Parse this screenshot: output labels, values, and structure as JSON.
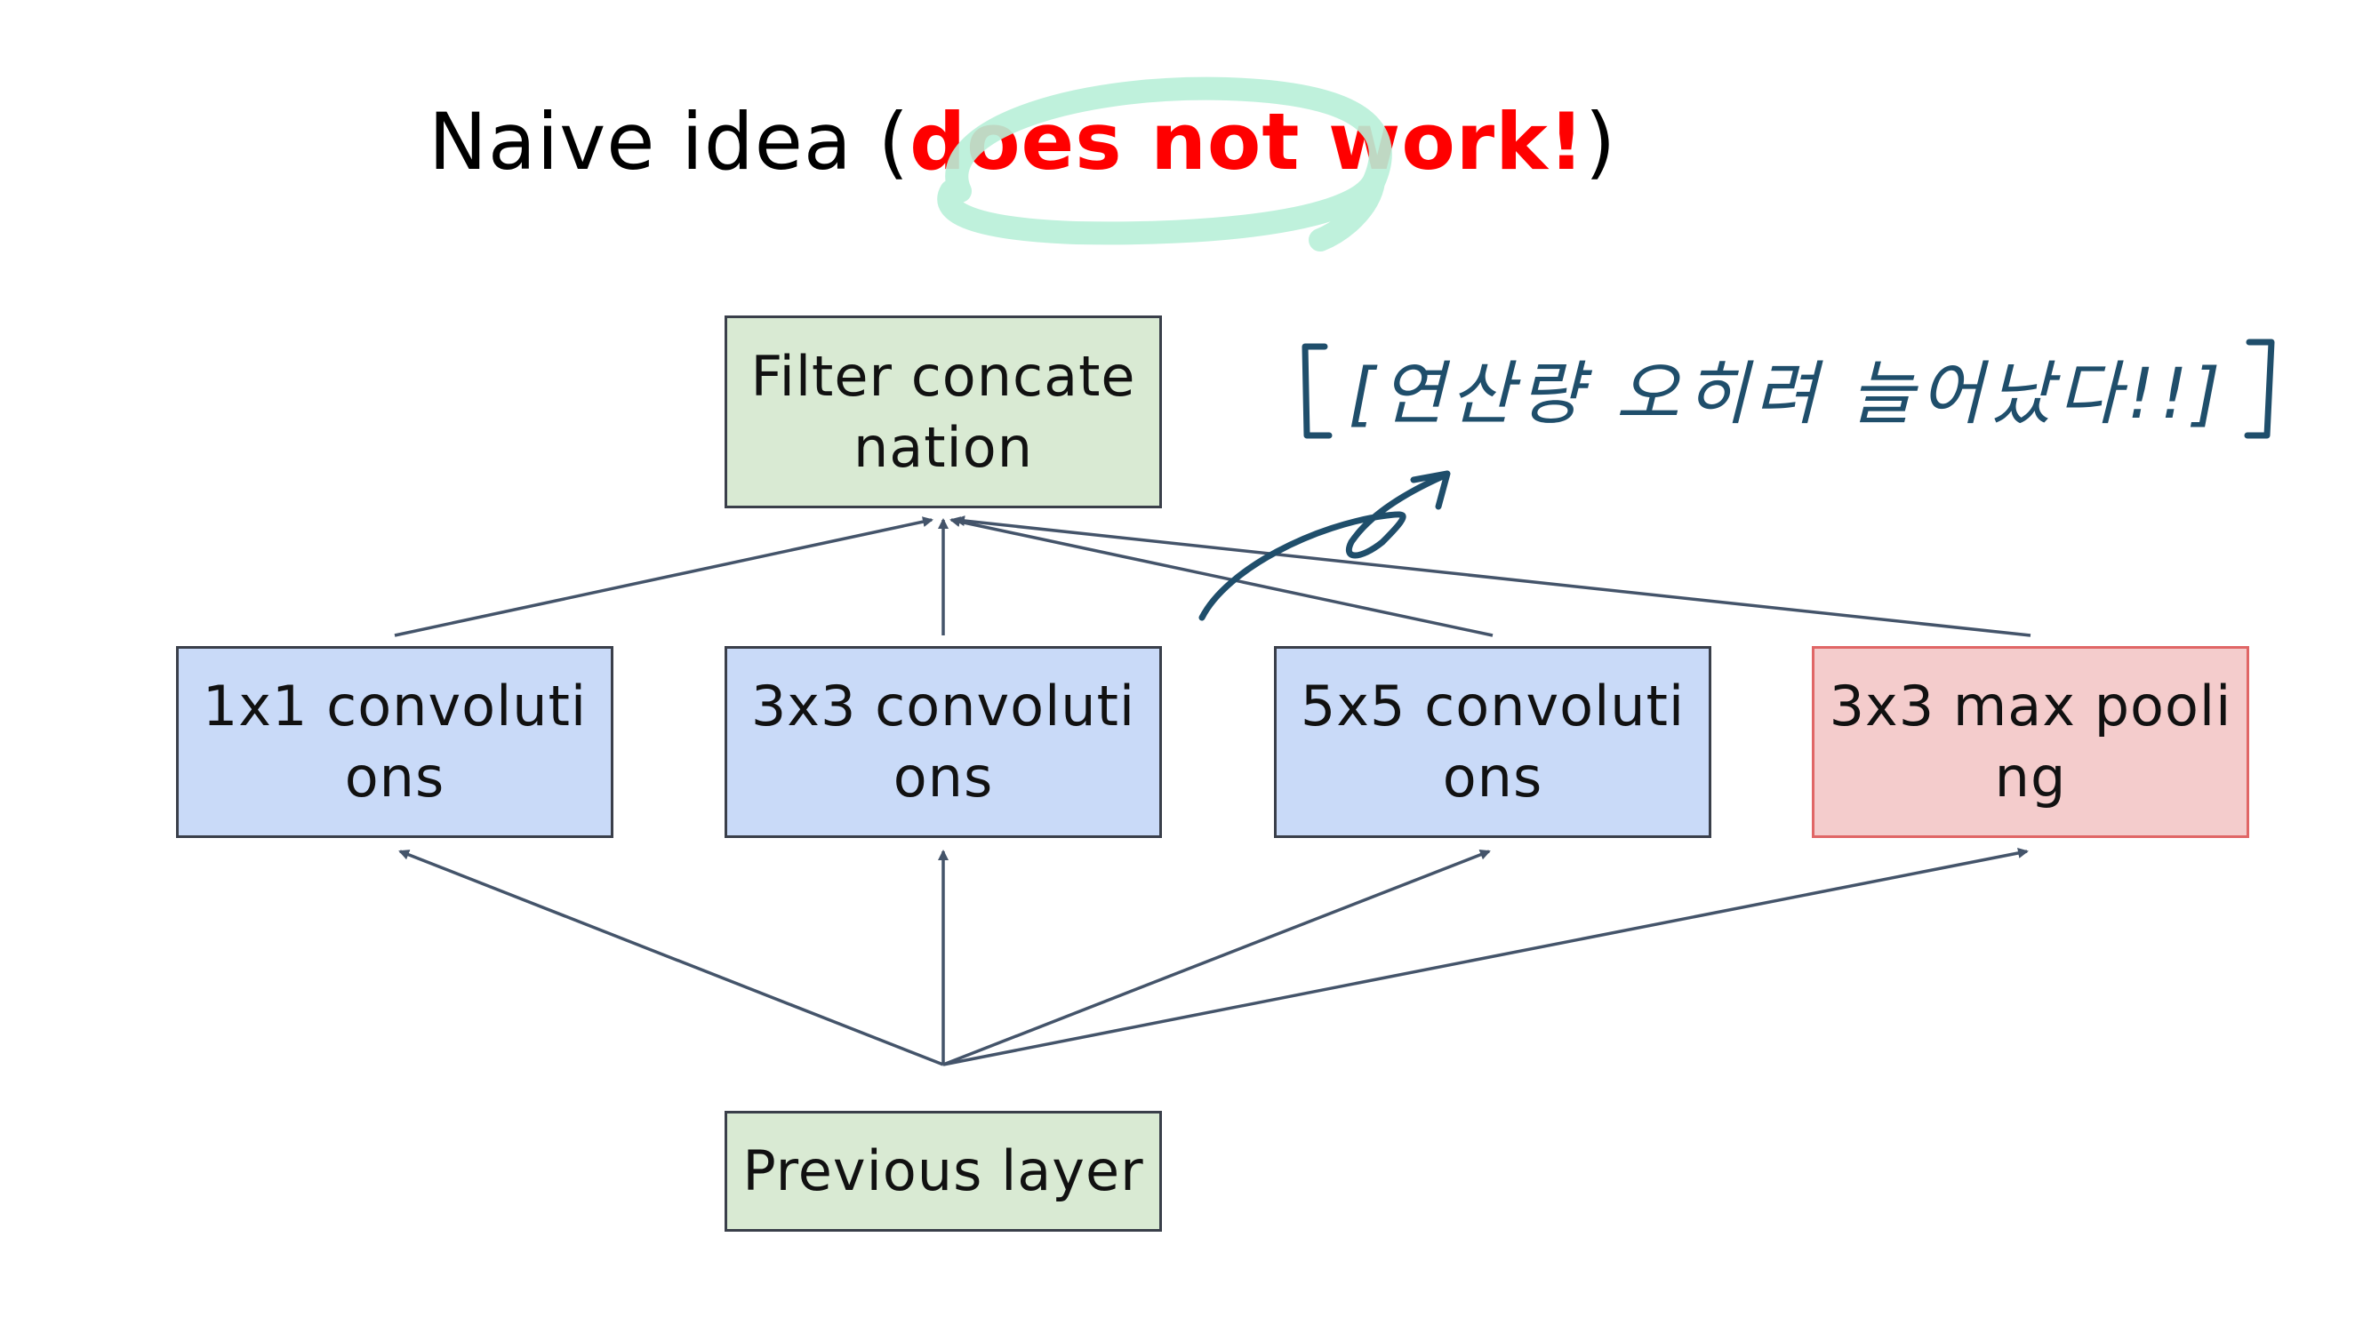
{
  "title": {
    "prefix": "Naive idea (",
    "emphasis": "does not work!",
    "suffix": ")"
  },
  "boxes": {
    "filter_concat": "Filter concate\nnation",
    "conv_1x1": "1x1 convoluti\nons",
    "conv_3x3": "3x3 convoluti\nons",
    "conv_5x5": "5x5 convoluti\nons",
    "max_pool": "3x3 max pooli\nng",
    "previous_layer": "Previous layer"
  },
  "annotation": {
    "handwritten_note": "[연산량 오히려 늘어났다!!]"
  },
  "colors": {
    "green_box": "#d9ead3",
    "blue_box": "#c9daf8",
    "pink_box": "#f4cccc",
    "pink_border": "#e06666",
    "emphasis_text": "#ff0000",
    "arrow": "#44546a",
    "highlight_scribble": "#b8f0d8",
    "handwriting_ink": "#1f4e6b"
  }
}
